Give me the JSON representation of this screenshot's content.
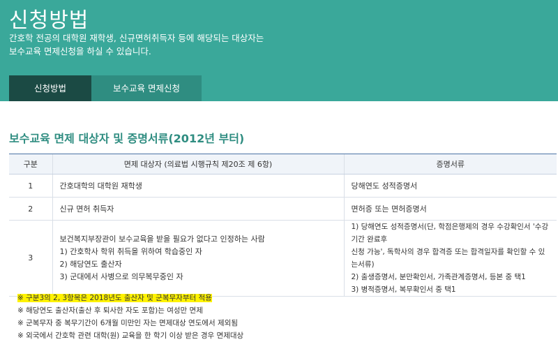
{
  "hero": {
    "title": "신청방법",
    "desc_line1": "간호학 전공의 대학원 재학생, 신규면허취득자 등에 해당되는 대상자는",
    "desc_line2": "보수교육 면제신청을 하실 수 있습니다."
  },
  "tabs": [
    {
      "label": "신청방법",
      "active": true
    },
    {
      "label": "보수교육 면제신청",
      "active": false
    }
  ],
  "section": {
    "title": "보수교육 면제 대상자 및 증명서류(2012년 부터)"
  },
  "table": {
    "headers": [
      "구분",
      "면제 대상자 (의료법 시행규칙 제20조 제 6항)",
      "증명서류"
    ],
    "rows": [
      {
        "no": "1",
        "target": [
          "간호대학의 대학원 재학생"
        ],
        "docs": [
          "당해연도 성적증명서"
        ]
      },
      {
        "no": "2",
        "target": [
          "신규 면허 취득자"
        ],
        "docs": [
          "면허증 또는 면허증명서"
        ]
      },
      {
        "no": "3",
        "target": [
          "보건복지부장관이 보수교육을 받을 필요가 없다고 인정하는 사람",
          "1) 간호학사 학위 취득을 위하여 학습중인 자",
          "2) 해당연도 출산자",
          "3) 군대에서 사병으로 의무복무중인 자"
        ],
        "docs": [
          "1) 당해연도 성적증명서(단, 학점은행제의 경우 수강확인서 '수강기간 완료후",
          "신청 가능', 독학사의 경우 합격증 또는 합격일자를 확인할 수 있는서류)",
          "2) 출생증명서, 분만확인서, 가족관계증명서, 등본 중 택1",
          "3) 병적증명서, 복무확인서 중 택1"
        ]
      }
    ]
  },
  "notes": [
    "※ 구분3의 2, 3항목은 2018년도 출산자 및 군복무자부터 적용",
    "※ 해당연도 출산자(출산 후 퇴사한 자도 포함)는 여성만 면제",
    "※ 군복무자 중 복무기간이 6개월 미만인 자는 면제대상 연도에서 제외됨",
    "※ 외국에서 간호학 관련 대학(원) 교육을 한 학기 이상 받은 경우 면제대상"
  ],
  "colors": {
    "hero_bg": "#3aa89a",
    "tab_active": "#1b4a44",
    "tab_inactive": "#2f8d81",
    "title_green": "#2f8d81",
    "table_header_bg": "#f0f4f9",
    "highlight": "#fff200"
  }
}
